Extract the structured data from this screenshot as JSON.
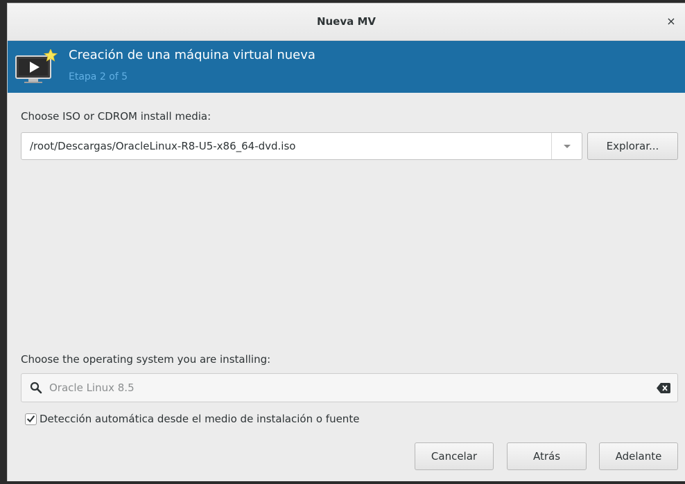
{
  "window": {
    "title": "Nueva MV",
    "close_glyph": "×"
  },
  "banner": {
    "title": "Creación de una máquina virtual nueva",
    "step": "Etapa 2 of 5",
    "icon": "monitor-play-icon",
    "color": "#1c6ea4"
  },
  "media": {
    "label": "Choose ISO or CDROM install media:",
    "value": "/root/Descargas/OracleLinux-R8-U5-x86_64-dvd.iso",
    "browse_label": "Explorar..."
  },
  "os": {
    "label": "Choose the operating system you are installing:",
    "search_placeholder": "Oracle Linux 8.5",
    "auto_detect_label": "Detección automática desde el medio de instalación o fuente",
    "auto_detect_checked": true
  },
  "buttons": {
    "cancel": "Cancelar",
    "back": "Atrás",
    "forward": "Adelante"
  }
}
